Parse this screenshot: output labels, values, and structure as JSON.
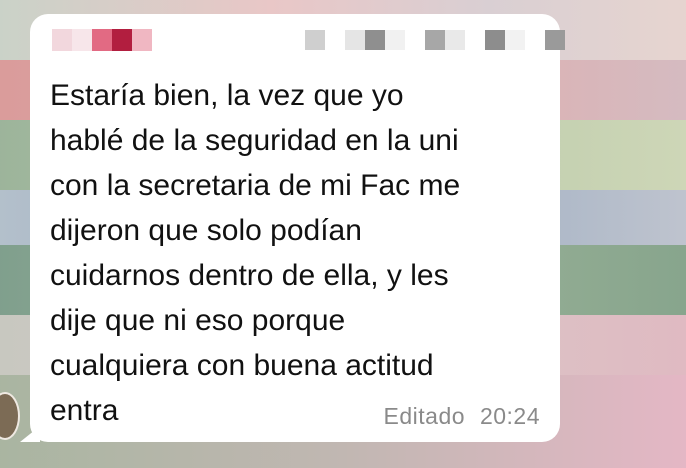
{
  "chat": {
    "message": {
      "text": "Estaría bien, la vez que yo\nhablé de la seguridad en la uni\ncon la secretaria de mi Fac me\ndijeron que solo podían\ncuidarnos dentro de ella, y les\ndije que ni eso porque\ncualquiera con buena actitud\nentra",
      "edited_label": "Editado",
      "time": "20:24"
    },
    "colors": {
      "bubble": "#ffffff",
      "text": "#111111",
      "meta_text": "#8a8a8a",
      "sender_name_pixels": [
        "#f2d7dd",
        "#e26a83",
        "#b21e3f",
        "#f0b7c2"
      ]
    },
    "icons": {
      "avatar": "avatar"
    }
  }
}
